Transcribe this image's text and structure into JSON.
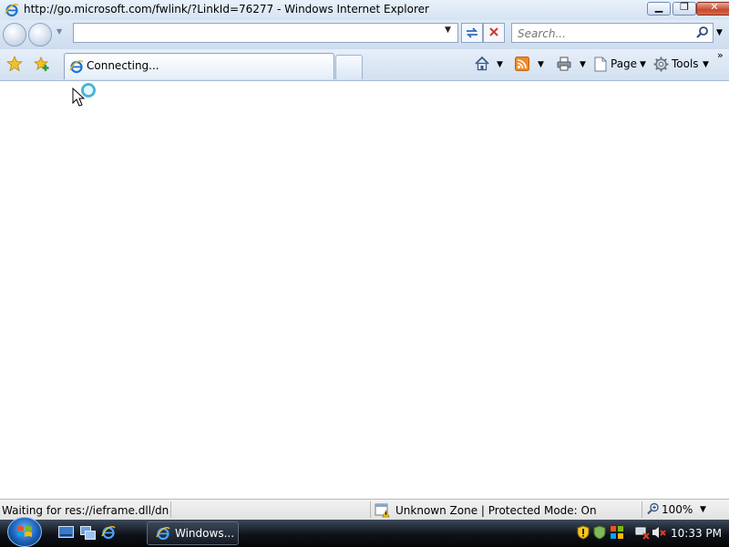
{
  "window": {
    "title": "http://go.microsoft.com/fwlink/?LinkId=76277 - Windows Internet Explorer",
    "minimize_icon": "minimize-icon",
    "maximize_icon": "restore-icon",
    "close_icon": "close-icon"
  },
  "navigation": {
    "address_value": "",
    "search_placeholder": "Search..."
  },
  "tab": {
    "label": "Connecting..."
  },
  "commandbar": {
    "page_label": "Page",
    "tools_label": "Tools",
    "overflow_label": "»"
  },
  "statusbar": {
    "status_text": "Waiting for res://ieframe.dll/dnserr",
    "zone_text": "Unknown Zone | Protected Mode: On",
    "zoom_text": "100%"
  },
  "taskbar": {
    "task_label": "Windows...",
    "clock": "10:33 PM"
  },
  "colors": {
    "accent": "#1b5fb4",
    "close": "#c44a2f"
  }
}
